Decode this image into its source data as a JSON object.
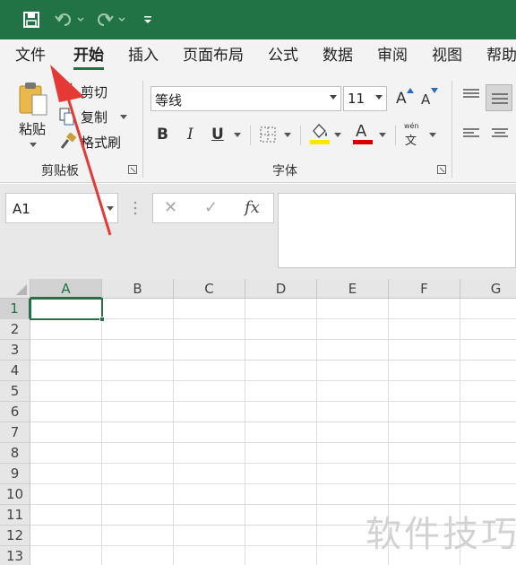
{
  "colors": {
    "excel_green": "#217346",
    "arrow_red": "#e53935",
    "fill_yellow": "#ffe600",
    "font_red": "#d40000"
  },
  "quick_access": {
    "save_icon": "save-icon",
    "undo_icon": "undo-icon",
    "redo_icon": "redo-icon",
    "customize_icon": "customize-qat-icon"
  },
  "tabs": [
    "文件",
    "开始",
    "插入",
    "页面布局",
    "公式",
    "数据",
    "审阅",
    "视图",
    "帮助"
  ],
  "active_tab": "开始",
  "clipboard": {
    "paste_label": "粘贴",
    "cut_label": "剪切",
    "copy_label": "复制",
    "format_painter_label": "格式刷",
    "group_label": "剪贴板"
  },
  "font": {
    "font_name": "等线",
    "font_size": "11",
    "bold": "B",
    "italic": "I",
    "underline": "U",
    "grow_font": "A",
    "shrink_font": "A",
    "font_color": "A",
    "phonetic_top": "wén",
    "phonetic_bottom": "文",
    "group_label": "字体"
  },
  "formula_bar": {
    "name_box": "A1",
    "cancel_symbol": "✕",
    "enter_symbol": "✓",
    "fx_label": "fx",
    "formula_value": ""
  },
  "grid": {
    "columns": [
      "A",
      "B",
      "C",
      "D",
      "E",
      "F",
      "G"
    ],
    "rows": [
      "1",
      "2",
      "3",
      "4",
      "5",
      "6",
      "7",
      "8",
      "9",
      "10",
      "11",
      "12",
      "13"
    ],
    "selected_cell": "A1"
  },
  "watermark": "软件技巧"
}
